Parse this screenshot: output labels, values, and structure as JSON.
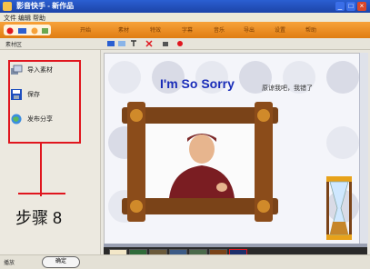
{
  "window": {
    "title": "影音快手 - 新作品",
    "menus": [
      "文件",
      "编辑",
      "帮助"
    ]
  },
  "ribbon": {
    "tabs": [
      "开始",
      "素材",
      "特效",
      "字幕",
      "音乐",
      "导出",
      "设置",
      "帮助"
    ]
  },
  "toolbar": {
    "label": "素材区"
  },
  "left_panel": {
    "items": [
      {
        "label": "导入素材",
        "icon": "import-icon"
      },
      {
        "label": "保存",
        "icon": "save-icon"
      },
      {
        "label": "发布分享",
        "icon": "globe-icon"
      }
    ]
  },
  "annotation": {
    "step_label": "步骤 8"
  },
  "bottom": {
    "left_label": "播放",
    "button_label": "确定"
  },
  "canvas": {
    "headline": "I'm So Sorry",
    "subline": "原谅我吧，我错了"
  },
  "colors": {
    "titlebar": "#1c44a8",
    "ribbon": "#e07d12",
    "annotation_red": "#e0161e",
    "headline_blue": "#1a2db8"
  }
}
